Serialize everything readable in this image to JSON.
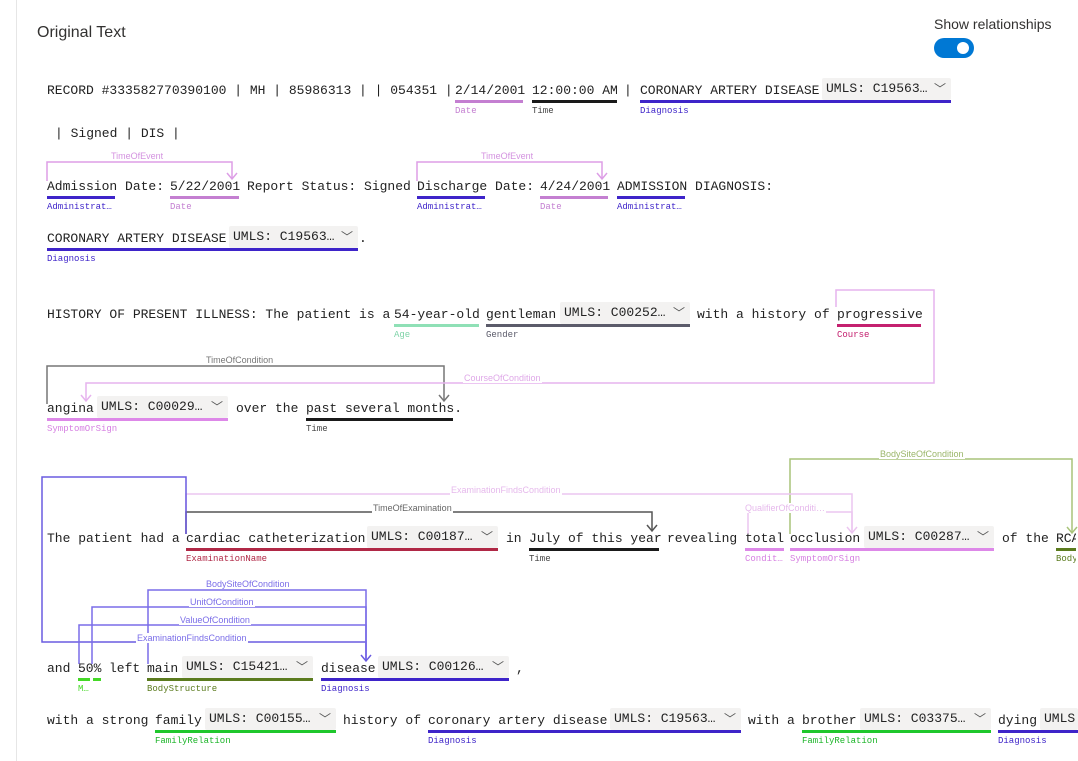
{
  "header": {
    "title": "Original Text",
    "toggle_label": "Show relationships",
    "toggle_on": true
  },
  "colors": {
    "accent": "#0078d4",
    "Date": "#c47fd1",
    "Time": "#1a1a1a",
    "Diagnosis": "#3e24c9",
    "Administrative": "#3e24c9",
    "Age": "#8fe0b6",
    "Gender": "#5b5b6a",
    "Course": "#c4206f",
    "SymptomOrSign": "#dd88e8",
    "ExaminationName": "#b02846",
    "BodyStructure": "#5b7b1e",
    "FamilyRelation": "#1fc72c",
    "Measurement": "#44d826",
    "Relation": "#9a8cf0"
  },
  "tokens": [
    {
      "text": "RECORD #333582770390100 | MH | 85986313 | | 054351 |"
    },
    {
      "text": "2/14/2001",
      "label": "Date"
    },
    {
      "text": "12:00:00 AM",
      "label": "Time"
    },
    {
      "text": "|"
    },
    {
      "text": "CORONARY ARTERY DISEASE",
      "label": "Diagnosis"
    },
    {
      "umls": "UMLS: C19563…"
    },
    {
      "text": "| Signed | DIS |"
    },
    {
      "text": "Admission Date:",
      "label": "Administrat…"
    },
    {
      "text": "5/22/2001",
      "label": "Date"
    },
    {
      "text": "Report Status: Signed"
    },
    {
      "text": "Discharge Date:",
      "label": "Administrat…"
    },
    {
      "text": "4/24/2001",
      "label": "Date"
    },
    {
      "text": "ADMISSION DIAGNOSIS:",
      "label": "Administrat…"
    },
    {
      "text": "CORONARY ARTERY DISEASE",
      "label": "Diagnosis"
    },
    {
      "umls": "UMLS: C19563…"
    },
    {
      "text": "."
    },
    {
      "text": "HISTORY OF PRESENT ILLNESS: The patient is a"
    },
    {
      "text": "54-year-old",
      "label": "Age"
    },
    {
      "text": "gentleman",
      "label": "Gender"
    },
    {
      "umls": "UMLS: C00252…"
    },
    {
      "text": "with a history of"
    },
    {
      "text": "progressive",
      "label": "Course"
    },
    {
      "text": "angina",
      "label": "SymptomOrSign"
    },
    {
      "umls": "UMLS: C00029…"
    },
    {
      "text": "over the"
    },
    {
      "text": "past several months.",
      "label": "Time"
    },
    {
      "text": "The patient had a"
    },
    {
      "text": "cardiac catheterization",
      "label": "ExaminationName"
    },
    {
      "umls": "UMLS: C00187…"
    },
    {
      "text": "in"
    },
    {
      "text": "July of this year",
      "label": "Time"
    },
    {
      "text": "revealing"
    },
    {
      "text": "total",
      "label": "Condit…"
    },
    {
      "text": "occlusion",
      "label": "SymptomOrSign"
    },
    {
      "umls": "UMLS: C00287…"
    },
    {
      "text": "of the"
    },
    {
      "text": "RCA",
      "label": "Body"
    },
    {
      "text": "and"
    },
    {
      "text": "50%",
      "label": "M…"
    },
    {
      "text": "left"
    },
    {
      "text": "main",
      "label": "BodyStructure"
    },
    {
      "umls": "UMLS: C15421…"
    },
    {
      "text": "disease",
      "label": "Diagnosis"
    },
    {
      "umls": "UMLS: C00126…"
    },
    {
      "text": ","
    },
    {
      "text": "with a strong"
    },
    {
      "text": "family",
      "label": "FamilyRelation"
    },
    {
      "umls": "UMLS: C00155…"
    },
    {
      "text": "history of"
    },
    {
      "text": "coronary artery disease",
      "label": "Diagnosis"
    },
    {
      "umls": "UMLS: C19563…"
    },
    {
      "text": "with a"
    },
    {
      "text": "brother",
      "label": "FamilyRelation"
    },
    {
      "umls": "UMLS: C03375…"
    },
    {
      "text": "dying",
      "label": "Diagnosis"
    },
    {
      "umls": "UMLS"
    }
  ],
  "relations": [
    {
      "label": "TimeOfEvent"
    },
    {
      "label": "TimeOfEvent"
    },
    {
      "label": "TimeOfCondition"
    },
    {
      "label": "CourseOfCondition"
    },
    {
      "label": "BodySiteOfCondition"
    },
    {
      "label": "ExaminationFindsCondition"
    },
    {
      "label": "TimeOfExamination"
    },
    {
      "label": "QualifierOfConditi…"
    },
    {
      "label": "BodySiteOfCondition"
    },
    {
      "label": "UnitOfCondition"
    },
    {
      "label": "ValueOfCondition"
    },
    {
      "label": "ExaminationFindsCondition"
    }
  ]
}
